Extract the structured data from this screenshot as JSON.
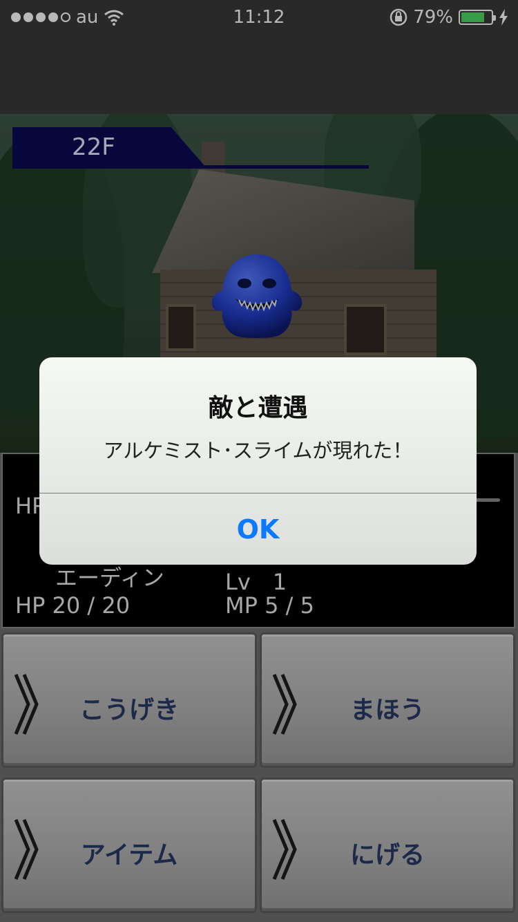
{
  "status_bar": {
    "carrier": "au",
    "time": "11:12",
    "battery_percent": "79%",
    "battery_level": 0.79
  },
  "scene": {
    "floor": "22F"
  },
  "party": {
    "hp_label_top": "HP",
    "member_name": "エーディン",
    "level": "Lv　1",
    "hp": "HP  20 / 20",
    "mp": "MP  5 / 5"
  },
  "commands": {
    "attack": "こうげき",
    "magic": "まほう",
    "item": "アイテム",
    "flee": "にげる"
  },
  "alert": {
    "title": "敵と遭遇",
    "message": "アルケミスト･スライムが現れた！",
    "ok_label": "OK"
  },
  "colors": {
    "accent_blue": "#0a7aff",
    "command_text": "#273a66",
    "banner_navy": "#0a0a52",
    "battery_green": "#4cd964"
  }
}
